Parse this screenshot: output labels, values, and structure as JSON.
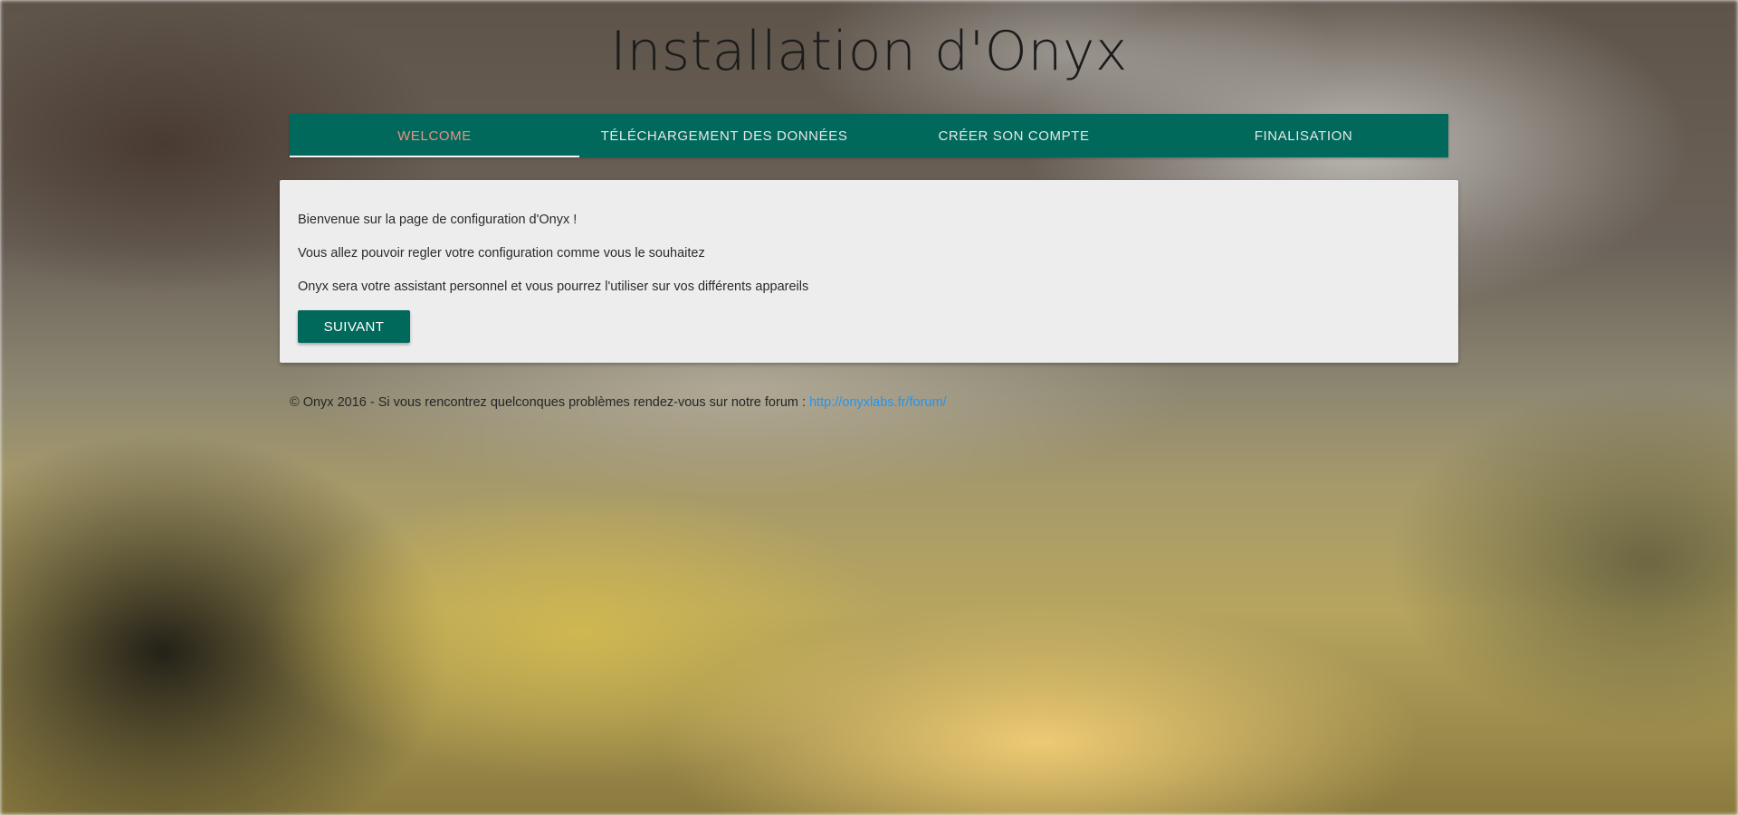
{
  "page": {
    "title": "Installation d'Onyx"
  },
  "tabs": [
    {
      "label": "WELCOME",
      "active": true
    },
    {
      "label": "TÉLÉCHARGEMENT DES DONNÉES",
      "active": false
    },
    {
      "label": "CRÉER SON COMPTE",
      "active": false
    },
    {
      "label": "FINALISATION",
      "active": false
    }
  ],
  "card": {
    "lines": [
      "Bienvenue sur la page de configuration d'Onyx !",
      "Vous allez pouvoir regler votre configuration comme vous le souhaitez",
      "Onyx sera votre assistant personnel et vous pourrez l'utiliser sur vos différents appareils"
    ],
    "next_button": "SUIVANT"
  },
  "footer": {
    "text": "© Onyx 2016 - Si vous rencontrez quelconques problèmes rendez-vous sur notre forum : ",
    "link_text": "http://onyxlabs.fr/forum/"
  },
  "colors": {
    "tab_bar": "#00695c",
    "active_tab_text": "#ef8f85",
    "button": "#00695c",
    "link": "#2196f3",
    "card_background": "#ededed"
  }
}
